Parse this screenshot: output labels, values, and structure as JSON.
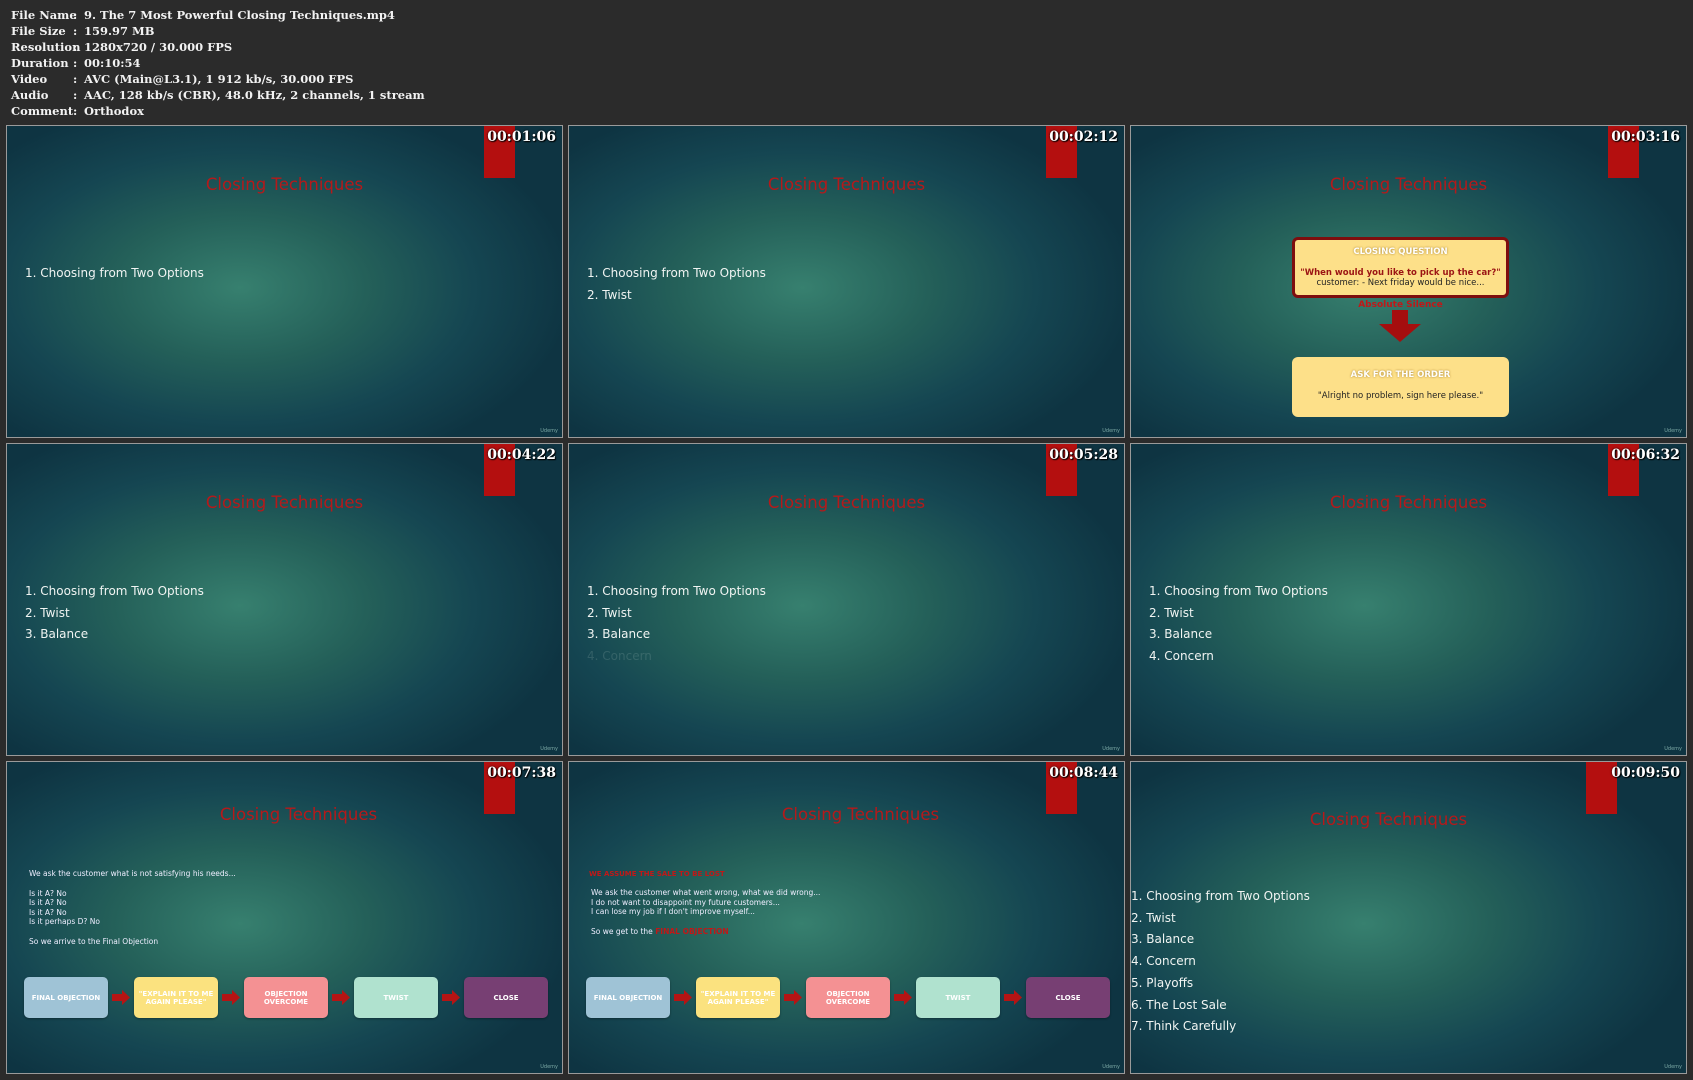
{
  "info": [
    {
      "key": "File Name",
      "value": "9. The 7 Most Powerful Closing Techniques.mp4"
    },
    {
      "key": "File Size",
      "value": "159.97 MB"
    },
    {
      "key": "Resolution",
      "value": "1280x720 / 30.000 FPS"
    },
    {
      "key": "Duration",
      "value": "00:10:54"
    },
    {
      "key": "Video",
      "value": "AVC (Main@L3.1), 1 912 kb/s, 30.000 FPS"
    },
    {
      "key": "Audio",
      "value": "AAC, 128 kb/s (CBR), 48.0 kHz, 2 channels, 1 stream"
    },
    {
      "key": "Comment",
      "value": "Orthodox"
    }
  ],
  "separator": ":",
  "slide_title": "Closing Techniques",
  "logo_text": "Udemy",
  "timestamps": [
    "00:01:06",
    "00:02:12",
    "00:03:16",
    "00:04:22",
    "00:05:28",
    "00:06:32",
    "00:07:38",
    "00:08:44",
    "00:09:50"
  ],
  "list_items": [
    "1. Choosing from Two Options",
    "2. Twist",
    "3. Balance",
    "4. Concern",
    "5. Playoffs",
    "6. The Lost Sale",
    "7. Think Carefully"
  ],
  "closing_question": {
    "head": "CLOSING QUESTION",
    "quote": "\"When would you like to pick up the car?\"",
    "answer": "customer: - Next friday would be nice...",
    "silence": "Absolute Silence",
    "order_head": "ASK FOR THE ORDER",
    "order_text": "\"Alright no problem, sign here please.\""
  },
  "slide7": {
    "intro": "We ask the customer what is not satisfying his needs...",
    "q1": "Is it A? No",
    "q2": "Is it A? No",
    "q3": "Is it A? No",
    "q4": "Is it perhaps D? No",
    "outro": "So we arrive to the Final Objection"
  },
  "slide8": {
    "head": "WE ASSUME THE SALE TO BE LOST",
    "l1": "We ask the customer what went wrong, what we did wrong...",
    "l2": "I do not want to disappoint my future customers...",
    "l3": "I can lose my job if I don't improve myself...",
    "outro_prefix": "So we get to the",
    "outro_red": "FINAL OBJECTION"
  },
  "flow": [
    {
      "label": "FINAL OBJECTION",
      "color": "#9fc3d6"
    },
    {
      "label": "\"EXPLAIN IT TO ME AGAIN PLEASE\"",
      "color": "#fbe27f"
    },
    {
      "label": "OBJECTION OVERCOME",
      "color": "#f49193"
    },
    {
      "label": "TWIST",
      "color": "#b0e2cf"
    },
    {
      "label": "CLOSE",
      "color": "#773f73"
    }
  ],
  "colors": {
    "ribbon": "#b40f0f",
    "title": "#b6191a",
    "arrow": "#b51414"
  }
}
